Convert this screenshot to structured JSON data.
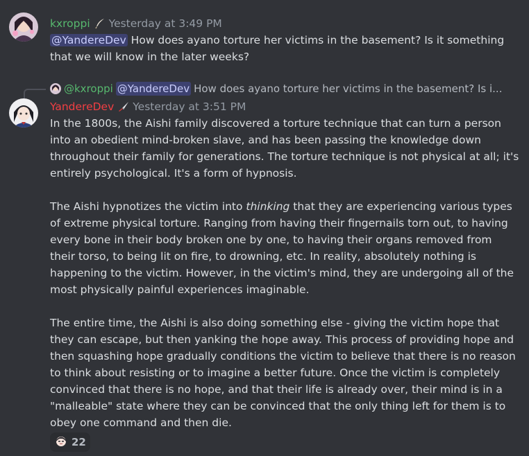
{
  "colors": {
    "background": "#313338",
    "kxroppi_name": "#57b86e",
    "yanderedev_name": "#f23f43",
    "mention_bg": "#3c4270",
    "mention_text": "#c9cdfb",
    "timestamp": "#949ba4"
  },
  "messages": [
    {
      "author": "kxroppi",
      "badge_icon": "quill-pen-icon",
      "timestamp": "Yesterday at 3:49 PM",
      "mention": "@YandereDev",
      "text_after_mention": " How does ayano torture her victims in the basement? Is it something that we will know in the later weeks?"
    },
    {
      "reply": {
        "author": "@kxroppi",
        "mention": "@YandereDev",
        "text": "How does ayano torture her victims in the basement? Is i..."
      },
      "author": "YandereDev",
      "badge_icon": "knife-icon",
      "timestamp": "Yesterday at 3:51 PM",
      "paragraphs": {
        "p1": "In the 1800s, the Aishi family discovered a torture technique that can turn a person into an obedient mind-broken slave, and has been passing the knowledge down throughout their family for generations. The torture technique is not physical at all; it's entirely psychological. It's a form of hypnosis.",
        "p2_before": "The Aishi hypnotizes the victim into ",
        "p2_italic": "thinking",
        "p2_after": " that they are experiencing various types of extreme physical torture. Ranging from having their fingernails torn out, to having every bone in their body broken one by one, to having their organs removed from their torso, to being lit on fire, to drowning, etc. In reality, absolutely nothing is happening to the victim. However, in the victim's mind, they are undergoing all of the most physically painful experiences imaginable.",
        "p3": "The entire time, the Aishi is also doing something else - giving the victim hope that they can escape, but then yanking the hope away. This process of providing hope and then squashing hope gradually conditions the victim to believe that there is no reason to think about resisting or to imagine a better future. Once the victim is completely convinced that there is no hope, and that their life is already over, their mind is in a \"malleable\" state where they can be convinced that the only thing left for them is to obey one command and then die."
      },
      "reaction": {
        "emoji_icon": "anime-face-emoji-icon",
        "count": "22"
      }
    }
  ]
}
